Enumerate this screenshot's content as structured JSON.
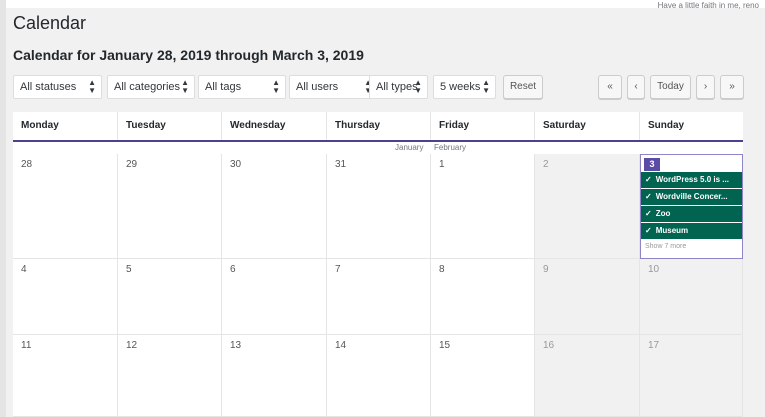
{
  "header": {
    "motto": "Have a little faith in me, reno",
    "page_title": "Calendar",
    "range_title": "Calendar for January 28, 2019 through March 3, 2019"
  },
  "filters": {
    "statuses": "All statuses",
    "categories": "All categories",
    "tags": "All tags",
    "users": "All users",
    "types": "All types",
    "weeks": "5 weeks",
    "reset": "Reset"
  },
  "nav": {
    "prev_far": "«",
    "prev": "‹",
    "today": "Today",
    "next": "›",
    "next_far": "»"
  },
  "calendar": {
    "days": [
      "Monday",
      "Tuesday",
      "Wednesday",
      "Thursday",
      "Friday",
      "Saturday",
      "Sunday"
    ],
    "month_left": "January",
    "month_right": "February",
    "weeks": [
      [
        "28",
        "29",
        "30",
        "31",
        "1",
        "2",
        "3"
      ],
      [
        "4",
        "5",
        "6",
        "7",
        "8",
        "9",
        "10"
      ],
      [
        "11",
        "12",
        "13",
        "14",
        "15",
        "16",
        "17"
      ]
    ],
    "today_events": [
      "WordPress 5.0 is ...",
      "Wordville Concer...",
      "Zoo",
      "Museum"
    ],
    "show_more": "Show 7 more",
    "check_glyph": "✓"
  }
}
